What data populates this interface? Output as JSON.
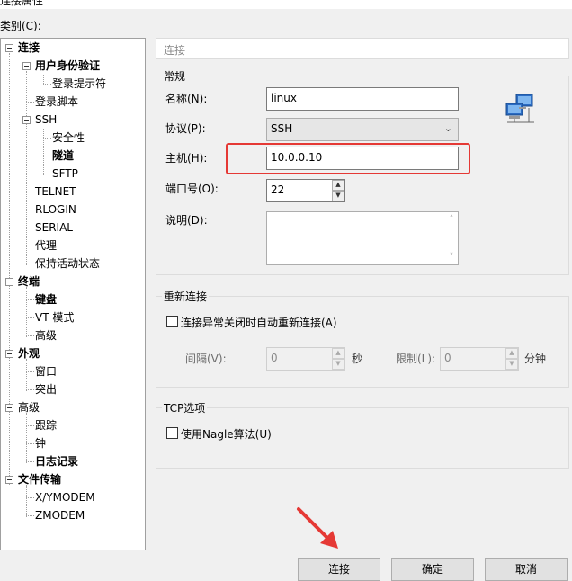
{
  "window": {
    "title": "连接属性"
  },
  "category_label": "类别(C):",
  "tree": {
    "items": [
      {
        "label": "连接"
      },
      {
        "label": "用户身份验证"
      },
      {
        "label": "登录提示符"
      },
      {
        "label": "登录脚本"
      },
      {
        "label": "SSH"
      },
      {
        "label": "安全性"
      },
      {
        "label": "隧道"
      },
      {
        "label": "SFTP"
      },
      {
        "label": "TELNET"
      },
      {
        "label": "RLOGIN"
      },
      {
        "label": "SERIAL"
      },
      {
        "label": "代理"
      },
      {
        "label": "保持活动状态"
      },
      {
        "label": "终端"
      },
      {
        "label": "键盘"
      },
      {
        "label": "VT 模式"
      },
      {
        "label": "高级"
      },
      {
        "label": "外观"
      },
      {
        "label": "窗口"
      },
      {
        "label": "突出"
      },
      {
        "label": "高级"
      },
      {
        "label": "跟踪"
      },
      {
        "label": "钟"
      },
      {
        "label": "日志记录"
      },
      {
        "label": "文件传输"
      },
      {
        "label": "X/YMODEM"
      },
      {
        "label": "ZMODEM"
      }
    ]
  },
  "panel": {
    "header": "连接",
    "general": {
      "title": "常规",
      "name_label": "名称(N):",
      "name_value": "linux",
      "protocol_label": "协议(P):",
      "protocol_value": "SSH",
      "host_label": "主机(H):",
      "host_value": "10.0.0.10",
      "port_label": "端口号(O):",
      "port_value": "22",
      "desc_label": "说明(D):",
      "desc_value": ""
    },
    "reconnect": {
      "title": "重新连接",
      "checkbox_label": "连接异常关闭时自动重新连接(A)",
      "interval_label": "间隔(V):",
      "interval_value": "0",
      "interval_unit": "秒",
      "limit_label": "限制(L):",
      "limit_value": "0",
      "limit_unit": "分钟"
    },
    "tcp": {
      "title": "TCP选项",
      "checkbox_label": "使用Nagle算法(U)"
    }
  },
  "buttons": {
    "connect": "连接",
    "ok": "确定",
    "cancel": "取消"
  },
  "colors": {
    "highlight": "#e53935",
    "arrow": "#e53935"
  }
}
